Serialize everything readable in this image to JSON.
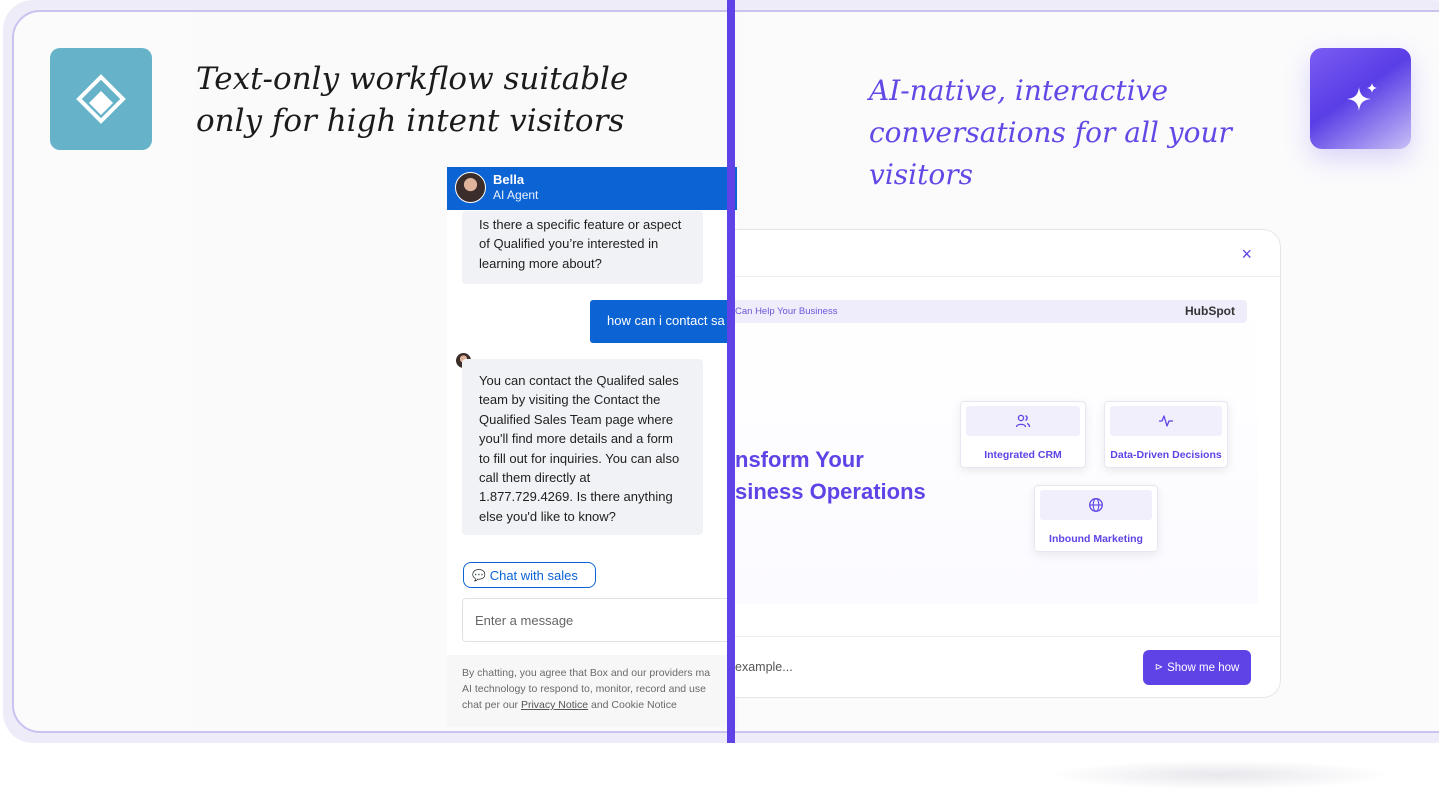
{
  "left_panel": {
    "tagline": "Text-only workflow suitable only for high intent visitors"
  },
  "right_panel": {
    "tagline": "AI-native, interactive conversations for all your visitors"
  },
  "chat": {
    "agent_name": "Bella",
    "agent_role": "AI Agent",
    "message_1": "Is there a specific feature or aspect of Qualified you’re interested in learning more about?",
    "user_message": "how can i contact sa",
    "message_2": "You can contact the Qualifed sales team by visiting the Contact the Qualified Sales Team page where you'll find more details and a form to fill out for inquiries. You can also call them directly at 1.877.729.4269. Is there anything else you'd like to know?",
    "chat_sales_label": "Chat with sales",
    "input_placeholder": "Enter a message",
    "disclaimer_line1": "By chatting, you agree that Box and our providers ma",
    "disclaimer_line2": "AI technology to respond to, monitor, record and use",
    "disclaimer_line3_pre": "chat per our ",
    "privacy_link": "Privacy Notice",
    "disclaimer_line3_post": " and Cookie Notice"
  },
  "modal": {
    "close_symbol": "×",
    "breadcrumb": "Can Help Your Business",
    "brand": "HubSpot",
    "headline_line1": "nsform Your",
    "headline_line2": "siness Operations",
    "features": [
      {
        "label": "Integrated CRM",
        "icon": "users-icon"
      },
      {
        "label": "Data-Driven Decisions",
        "icon": "activity-icon"
      },
      {
        "label": "Inbound Marketing",
        "icon": "globe-icon"
      }
    ],
    "input_text": "example...",
    "button_label": "Show me how"
  },
  "colors": {
    "accent": "#5f43e6",
    "chat_blue": "#0b63d4",
    "teal_logo": "#66b3c9"
  }
}
